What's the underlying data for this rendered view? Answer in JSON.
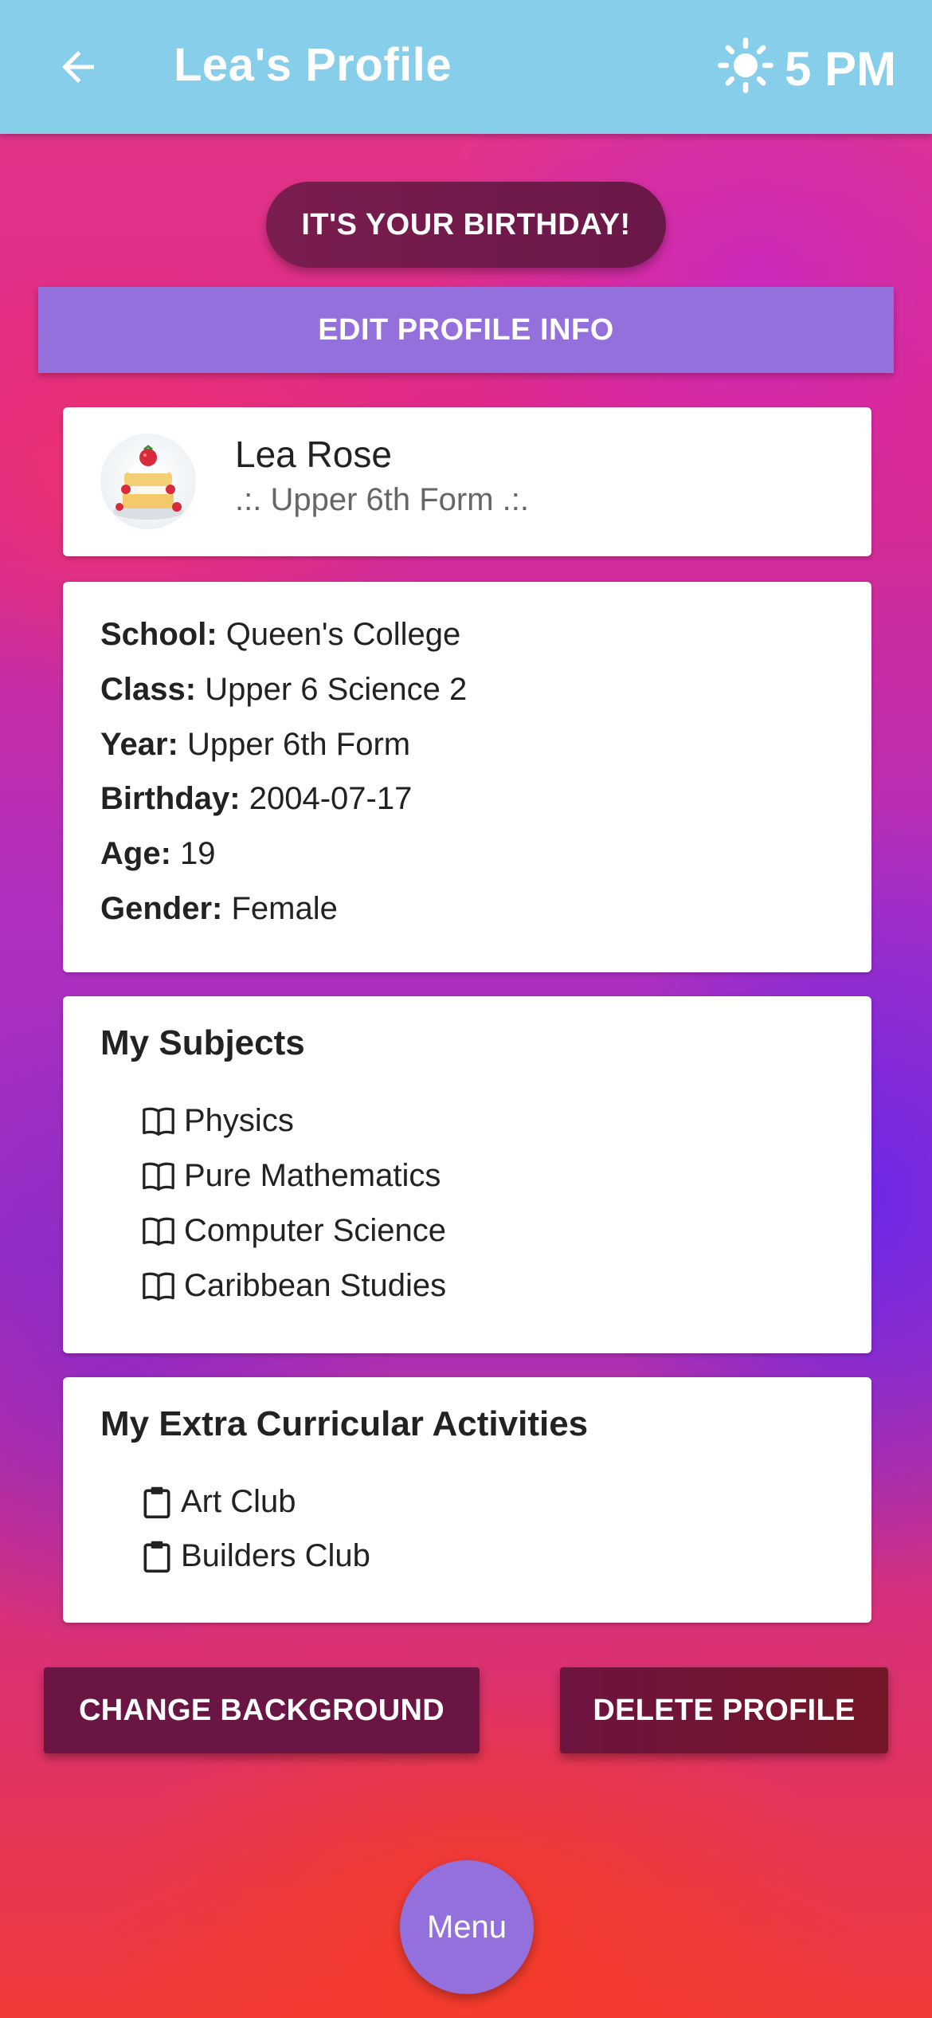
{
  "header": {
    "title": "Lea's Profile",
    "time": "5 PM",
    "weather_icon": "sun-icon",
    "back_icon": "arrow-left-icon",
    "background_color": "#87ceeb"
  },
  "birthday_banner": "IT'S YOUR BIRTHDAY!",
  "edit_button": "EDIT PROFILE INFO",
  "profile": {
    "name": "Lea Rose",
    "subtitle": ".:. Upper 6th Form .:."
  },
  "info": [
    {
      "label": "School:",
      "value": "Queen's College"
    },
    {
      "label": "Class:",
      "value": "Upper 6 Science 2"
    },
    {
      "label": "Year:",
      "value": "Upper 6th Form"
    },
    {
      "label": "Birthday:",
      "value": "2004-07-17"
    },
    {
      "label": "Age:",
      "value": "19"
    },
    {
      "label": "Gender:",
      "value": "Female"
    }
  ],
  "subjects": {
    "heading": "My Subjects",
    "icon": "book-icon",
    "items": [
      "Physics",
      "Pure Mathematics",
      "Computer Science",
      "Caribbean Studies"
    ]
  },
  "activities": {
    "heading": "My Extra Curricular Activities",
    "icon": "clipboard-icon",
    "items": [
      "Art Club",
      "Builders Club"
    ]
  },
  "buttons": {
    "change_background": "CHANGE BACKGROUND",
    "delete_profile": "DELETE PROFILE",
    "menu": "Menu"
  },
  "colors": {
    "accent": "#9370db",
    "dark_button": "#6a1544"
  }
}
